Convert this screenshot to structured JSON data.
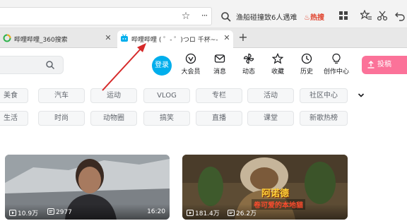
{
  "browser": {
    "search_box": {
      "text": "渔船碰撞致6人遇难",
      "badge": "热搜"
    },
    "tabs": [
      {
        "title": "哔哩哔哩_360搜索",
        "active": false
      },
      {
        "title": "哔哩哔哩 ( ゜- ゜)つロ 千杯~-",
        "active": true
      }
    ],
    "new_tab_label": "+",
    "more_label": "···"
  },
  "header": {
    "login_label": "登录",
    "nav": [
      {
        "label": "大会员",
        "icon": "vip-icon"
      },
      {
        "label": "消息",
        "icon": "mail-icon"
      },
      {
        "label": "动态",
        "icon": "windmill-icon"
      },
      {
        "label": "收藏",
        "icon": "star-icon"
      },
      {
        "label": "历史",
        "icon": "clock-icon"
      },
      {
        "label": "创作中心",
        "icon": "bulb-icon"
      }
    ],
    "upload_label": "投稿"
  },
  "channels": {
    "row1": [
      "美食",
      "汽车",
      "运动",
      "VLOG",
      "专栏",
      "活动",
      "社区中心"
    ],
    "row2": [
      "生活",
      "时尚",
      "动物圈",
      "搞笑",
      "直播",
      "课堂",
      "新歌热榜"
    ]
  },
  "videos": [
    {
      "views": "10.9万",
      "danmaku": "2977",
      "duration": "16:20"
    },
    {
      "views": "181.4万",
      "danmaku": "26.2万",
      "overlay_title": "阿诺德",
      "overlay_subtitle": "卷可爱的本地貓"
    }
  ],
  "colors": {
    "accent_blue": "#00aeec",
    "accent_pink": "#fb7299",
    "hot_red": "#e0402a",
    "annotation_red": "#d62a2a"
  }
}
